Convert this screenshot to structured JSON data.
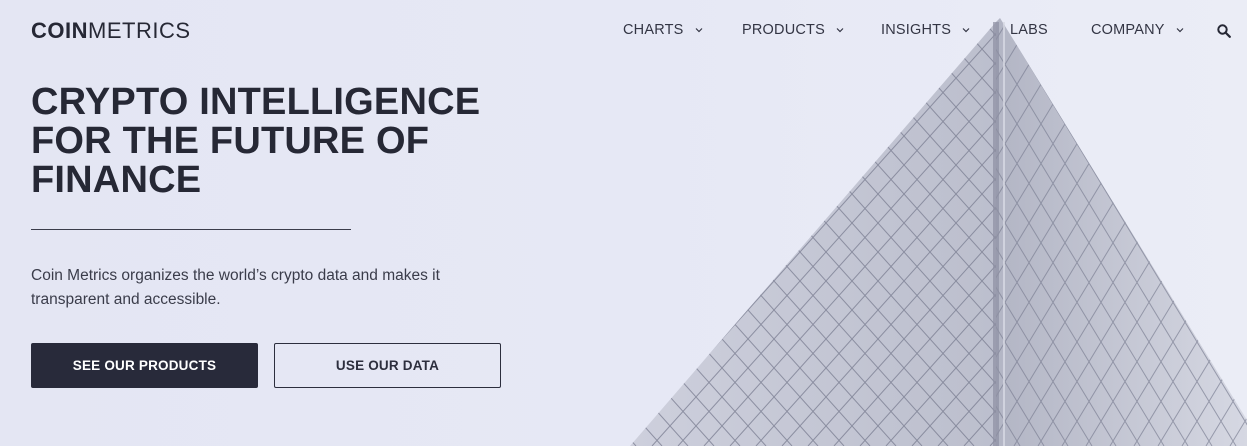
{
  "brand": {
    "logo_bold": "COIN",
    "logo_light": "METRICS"
  },
  "nav": {
    "items": [
      {
        "label": "CHARTS",
        "has_dropdown": true
      },
      {
        "label": "PRODUCTS",
        "has_dropdown": true
      },
      {
        "label": "INSIGHTS",
        "has_dropdown": true
      },
      {
        "label": "LABS",
        "has_dropdown": false
      },
      {
        "label": "COMPANY",
        "has_dropdown": true
      }
    ],
    "search_icon": "search-icon",
    "dropdown_icon": "chevron-down-icon"
  },
  "hero": {
    "headline_line1": "CRYPTO INTELLIGENCE",
    "headline_line2": "FOR THE FUTURE OF",
    "headline_line3": "FINANCE",
    "subtitle_line1": "Coin Metrics organizes the world’s crypto data and makes it",
    "subtitle_line2": "transparent and accessible.",
    "primary_button": "SEE OUR PRODUCTS",
    "secondary_button": "USE OUR DATA"
  },
  "colors": {
    "text_dark": "#262835",
    "button_dark": "#282a3a",
    "background": "#e6e8f4"
  }
}
